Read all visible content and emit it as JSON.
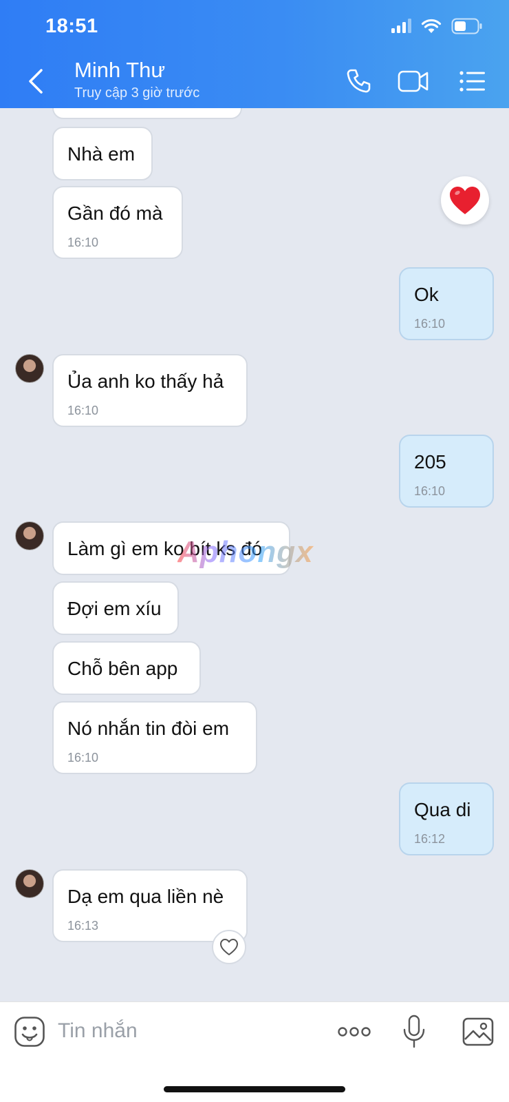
{
  "status_bar": {
    "time": "18:51"
  },
  "header": {
    "contact_name": "Minh Thư",
    "contact_status": "Truy cập 3 giờ trước"
  },
  "watermark": "Aphongx",
  "messages": [
    {
      "side": "in",
      "text": "Nhà em",
      "time": ""
    },
    {
      "side": "in",
      "text": "Gần đó mà",
      "time": "16:10"
    },
    {
      "side": "out",
      "text": "Ok",
      "time": "16:10"
    },
    {
      "side": "in",
      "text": "Ủa anh ko thấy hả",
      "time": "16:10"
    },
    {
      "side": "out",
      "text": "205",
      "time": "16:10"
    },
    {
      "side": "in",
      "text": "Làm gì em ko bít ks đó",
      "time": ""
    },
    {
      "side": "in",
      "text": "Đợi em xíu",
      "time": ""
    },
    {
      "side": "in",
      "text": "Chỗ bên app",
      "time": ""
    },
    {
      "side": "in",
      "text": "Nó nhắn tin đòi em",
      "time": "16:10"
    },
    {
      "side": "out",
      "text": "Qua di",
      "time": "16:12"
    },
    {
      "side": "in",
      "text": "Dạ em qua liền nè",
      "time": "16:13"
    }
  ],
  "input": {
    "placeholder": "Tin nhắn"
  },
  "colors": {
    "header_start": "#2f7df5",
    "header_end": "#4aa3ef",
    "outgoing_bubble": "#d6ecfb",
    "incoming_bubble": "#ffffff",
    "chat_bg": "#e4e8f0"
  },
  "icons": [
    "back-icon",
    "phone-icon",
    "video-icon",
    "menu-list-icon",
    "heart-icon",
    "sticker-icon",
    "more-icon",
    "mic-icon",
    "image-icon"
  ]
}
